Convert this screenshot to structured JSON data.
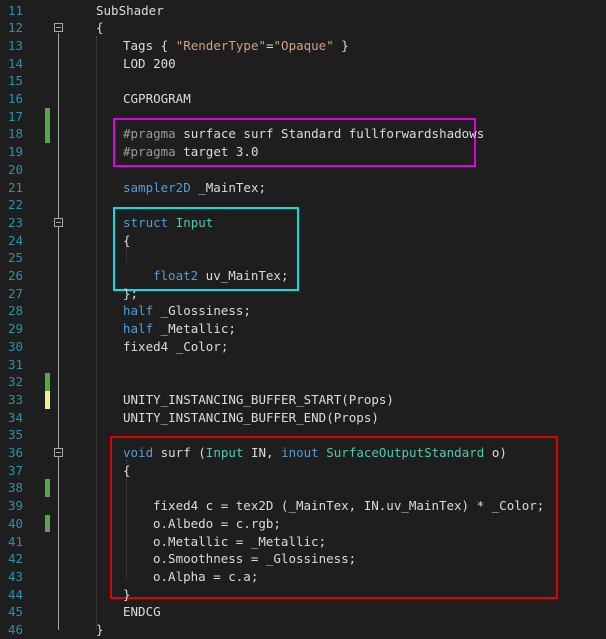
{
  "editor": {
    "lines": [
      {
        "num": "11",
        "segs": [
          {
            "t": "SubShader",
            "c": "pl"
          }
        ],
        "indent": 0
      },
      {
        "num": "12",
        "segs": [
          {
            "t": "{",
            "c": "pl"
          }
        ],
        "indent": 0,
        "fold": true
      },
      {
        "num": "13",
        "segs": [
          {
            "t": "Tags { ",
            "c": "pl"
          },
          {
            "t": "\"RenderType\"",
            "c": "st"
          },
          {
            "t": "=",
            "c": "pl"
          },
          {
            "t": "\"Opaque\"",
            "c": "st"
          },
          {
            "t": " }",
            "c": "pl"
          }
        ],
        "indent": 1
      },
      {
        "num": "14",
        "segs": [
          {
            "t": "LOD 200",
            "c": "pl"
          }
        ],
        "indent": 1
      },
      {
        "num": "15",
        "segs": [],
        "indent": 1
      },
      {
        "num": "16",
        "segs": [
          {
            "t": "CGPROGRAM",
            "c": "pl"
          }
        ],
        "indent": 1
      },
      {
        "num": "17",
        "segs": [],
        "indent": 1,
        "mark": "green"
      },
      {
        "num": "18",
        "segs": [
          {
            "t": "#pragma",
            "c": "pp"
          },
          {
            "t": " surface surf Standard fullforwardshadows",
            "c": "pl"
          }
        ],
        "indent": 1,
        "mark": "green"
      },
      {
        "num": "19",
        "segs": [
          {
            "t": "#pragma",
            "c": "pp"
          },
          {
            "t": " target 3.0",
            "c": "pl"
          }
        ],
        "indent": 1
      },
      {
        "num": "20",
        "segs": [],
        "indent": 1
      },
      {
        "num": "21",
        "segs": [
          {
            "t": "sampler2D",
            "c": "kw"
          },
          {
            "t": " _MainTex;",
            "c": "pl"
          }
        ],
        "indent": 1
      },
      {
        "num": "22",
        "segs": [],
        "indent": 1
      },
      {
        "num": "23",
        "segs": [
          {
            "t": "struct",
            "c": "kw"
          },
          {
            "t": " ",
            "c": "pl"
          },
          {
            "t": "Input",
            "c": "ty"
          }
        ],
        "indent": 1,
        "fold": true
      },
      {
        "num": "24",
        "segs": [
          {
            "t": "{",
            "c": "pl"
          }
        ],
        "indent": 1
      },
      {
        "num": "25",
        "segs": [],
        "indent": 1
      },
      {
        "num": "26",
        "segs": [
          {
            "t": "float2",
            "c": "kw"
          },
          {
            "t": " uv_MainTex;",
            "c": "pl"
          }
        ],
        "indent": 2
      },
      {
        "num": "27",
        "segs": [
          {
            "t": "};",
            "c": "pl"
          }
        ],
        "indent": 1
      },
      {
        "num": "28",
        "segs": [
          {
            "t": "half",
            "c": "kw"
          },
          {
            "t": " _Glossiness;",
            "c": "pl"
          }
        ],
        "indent": 1
      },
      {
        "num": "29",
        "segs": [
          {
            "t": "half",
            "c": "kw"
          },
          {
            "t": " _Metallic;",
            "c": "pl"
          }
        ],
        "indent": 1
      },
      {
        "num": "30",
        "segs": [
          {
            "t": "fixed4 _Color;",
            "c": "pl"
          }
        ],
        "indent": 1
      },
      {
        "num": "31",
        "segs": [],
        "indent": 1
      },
      {
        "num": "32",
        "segs": [],
        "indent": 1,
        "mark": "green"
      },
      {
        "num": "33",
        "segs": [
          {
            "t": "UNITY_INSTANCING_BUFFER_START(Props)",
            "c": "pl"
          }
        ],
        "indent": 1,
        "mark": "yellow"
      },
      {
        "num": "34",
        "segs": [
          {
            "t": "UNITY_INSTANCING_BUFFER_END(Props)",
            "c": "pl"
          }
        ],
        "indent": 1
      },
      {
        "num": "35",
        "segs": [],
        "indent": 1
      },
      {
        "num": "36",
        "segs": [
          {
            "t": "void",
            "c": "kw"
          },
          {
            "t": " surf (",
            "c": "pl"
          },
          {
            "t": "Input",
            "c": "ty"
          },
          {
            "t": " IN, ",
            "c": "pl"
          },
          {
            "t": "inout",
            "c": "kw"
          },
          {
            "t": " ",
            "c": "pl"
          },
          {
            "t": "SurfaceOutputStandard",
            "c": "ty"
          },
          {
            "t": " o)",
            "c": "pl"
          }
        ],
        "indent": 1,
        "fold": true
      },
      {
        "num": "37",
        "segs": [
          {
            "t": "{",
            "c": "pl"
          }
        ],
        "indent": 1
      },
      {
        "num": "38",
        "segs": [],
        "indent": 2,
        "mark": "green"
      },
      {
        "num": "39",
        "segs": [
          {
            "t": "fixed4 c = tex2D (_MainTex, IN.uv_MainTex) * _Color;",
            "c": "pl"
          }
        ],
        "indent": 2
      },
      {
        "num": "40",
        "segs": [
          {
            "t": "o.Albedo = c.rgb;",
            "c": "pl"
          }
        ],
        "indent": 2,
        "mark": "green"
      },
      {
        "num": "41",
        "segs": [
          {
            "t": "o.Metallic = _Metallic;",
            "c": "pl"
          }
        ],
        "indent": 2
      },
      {
        "num": "42",
        "segs": [
          {
            "t": "o.Smoothness = _Glossiness;",
            "c": "pl"
          }
        ],
        "indent": 2
      },
      {
        "num": "43",
        "segs": [
          {
            "t": "o.Alpha = c.a;",
            "c": "pl"
          }
        ],
        "indent": 2
      },
      {
        "num": "44",
        "segs": [
          {
            "t": "}",
            "c": "pl"
          }
        ],
        "indent": 1
      },
      {
        "num": "45",
        "segs": [
          {
            "t": "ENDCG",
            "c": "pl"
          }
        ],
        "indent": 1
      },
      {
        "num": "46",
        "segs": [
          {
            "t": "}",
            "c": "pl"
          }
        ],
        "indent": 0
      }
    ],
    "colors": {
      "background": "#1e1e1e",
      "line_number": "#2b91af",
      "keyword": "#569cd6",
      "preprocessor": "#9b9b9b",
      "type": "#4ec9b0",
      "string": "#d69d85",
      "plain": "#dcdcdc",
      "mark_green": "#57a64a",
      "mark_yellow": "#efef91",
      "highlight_magenta": "#e100e1",
      "highlight_cyan": "#00e1e1",
      "highlight_red": "#e10000"
    }
  }
}
